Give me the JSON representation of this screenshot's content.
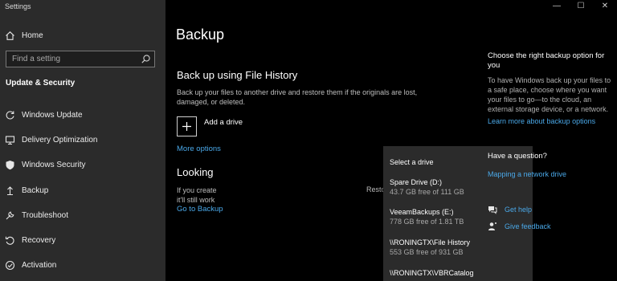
{
  "window": {
    "app_title": "Settings",
    "controls": {
      "minimize": "—",
      "maximize": "☐",
      "close": "✕"
    }
  },
  "sidebar": {
    "home_label": "Home",
    "search": {
      "placeholder": "Find a setting",
      "value": ""
    },
    "section_title": "Update & Security",
    "items": [
      {
        "label": "Windows Update",
        "icon": "refresh-icon"
      },
      {
        "label": "Delivery Optimization",
        "icon": "delivery-optimization-icon"
      },
      {
        "label": "Windows Security",
        "icon": "shield-icon"
      },
      {
        "label": "Backup",
        "icon": "backup-arrow-icon"
      },
      {
        "label": "Troubleshoot",
        "icon": "wrench-icon"
      },
      {
        "label": "Recovery",
        "icon": "recovery-icon"
      },
      {
        "label": "Activation",
        "icon": "activation-icon"
      }
    ]
  },
  "main": {
    "page_title": "Backup",
    "file_history": {
      "heading": "Back up using File History",
      "description": "Back up your files to another drive and restore them if the originals are lost, damaged, or deleted.",
      "add_drive_label": "Add a drive",
      "more_options": "More options"
    },
    "looking": {
      "heading": "Looking",
      "desc_line1": "If you create",
      "desc_line2": "it'll still work",
      "restore_tool": "Restore tool.",
      "go_to_backup": "Go to Backup"
    }
  },
  "dropdown": {
    "header": "Select a drive",
    "drives": [
      {
        "name": "Spare Drive (D:)",
        "free": "43.7 GB free of 111 GB"
      },
      {
        "name": "VeeamBackups (E:)",
        "free": "778 GB free of 1.81 TB"
      },
      {
        "name": "\\\\RONINGTX\\File History",
        "free": "553 GB free of 931 GB"
      },
      {
        "name": "\\\\RONINGTX\\VBRCatalog",
        "free": ""
      }
    ]
  },
  "right_panel": {
    "choose_heading": "Choose the right backup option for you",
    "choose_desc": "To have Windows back up your files to a safe place, choose where you want your files to go—to the cloud, an external storage device, or a network.",
    "learn_more_link": "Learn more about backup options",
    "question_heading": "Have a question?",
    "mapping_link": "Mapping a network drive",
    "get_help": "Get help",
    "give_feedback": "Give feedback"
  },
  "colors": {
    "sidebar_bg": "#2b2b2b",
    "main_bg": "#000000",
    "link": "#4aa8e8",
    "dropdown_bg": "#2b2b2b"
  }
}
